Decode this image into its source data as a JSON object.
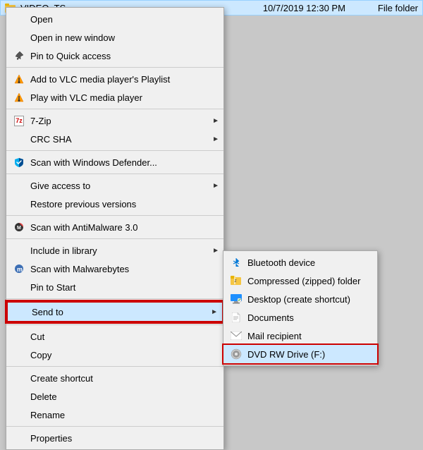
{
  "fileRow": {
    "name": "VIDEO_TS",
    "date": "10/7/2019 12:30 PM",
    "type": "File folder"
  },
  "contextMenu": {
    "items": [
      {
        "id": "open",
        "label": "Open",
        "icon": null,
        "hasArrow": false,
        "separator_after": false
      },
      {
        "id": "open-new-window",
        "label": "Open in new window",
        "icon": null,
        "hasArrow": false,
        "separator_after": false
      },
      {
        "id": "pin-quick-access",
        "label": "Pin to Quick access",
        "icon": "pin",
        "hasArrow": false,
        "separator_after": true
      },
      {
        "id": "vlc-playlist",
        "label": "Add to VLC media player's Playlist",
        "icon": "vlc",
        "hasArrow": false,
        "separator_after": false
      },
      {
        "id": "vlc-play",
        "label": "Play with VLC media player",
        "icon": "vlc",
        "hasArrow": false,
        "separator_after": true
      },
      {
        "id": "7zip",
        "label": "7-Zip",
        "icon": "7zip",
        "hasArrow": true,
        "separator_after": false
      },
      {
        "id": "crc-sha",
        "label": "CRC SHA",
        "icon": null,
        "hasArrow": true,
        "separator_after": true
      },
      {
        "id": "scan-defender",
        "label": "Scan with Windows Defender...",
        "icon": "defender",
        "hasArrow": false,
        "separator_after": true
      },
      {
        "id": "give-access",
        "label": "Give access to",
        "icon": null,
        "hasArrow": true,
        "separator_after": false
      },
      {
        "id": "restore-previous",
        "label": "Restore previous versions",
        "icon": null,
        "hasArrow": false,
        "separator_after": true
      },
      {
        "id": "scan-antimalware",
        "label": "Scan with AntiMalware 3.0",
        "icon": "antimalware",
        "hasArrow": false,
        "separator_after": true
      },
      {
        "id": "include-library",
        "label": "Include in library",
        "icon": null,
        "hasArrow": true,
        "separator_after": false
      },
      {
        "id": "scan-malwarebytes",
        "label": "Scan with Malwarebytes",
        "icon": "malwarebytes",
        "hasArrow": false,
        "separator_after": false
      },
      {
        "id": "pin-start",
        "label": "Pin to Start",
        "icon": null,
        "hasArrow": false,
        "separator_after": true
      },
      {
        "id": "send-to",
        "label": "Send to",
        "icon": null,
        "hasArrow": true,
        "separator_after": true,
        "highlighted": true
      },
      {
        "id": "cut",
        "label": "Cut",
        "icon": null,
        "hasArrow": false,
        "separator_after": false
      },
      {
        "id": "copy",
        "label": "Copy",
        "icon": null,
        "hasArrow": false,
        "separator_after": true
      },
      {
        "id": "create-shortcut",
        "label": "Create shortcut",
        "icon": null,
        "hasArrow": false,
        "separator_after": false
      },
      {
        "id": "delete",
        "label": "Delete",
        "icon": null,
        "hasArrow": false,
        "separator_after": false
      },
      {
        "id": "rename",
        "label": "Rename",
        "icon": null,
        "hasArrow": false,
        "separator_after": true
      },
      {
        "id": "properties",
        "label": "Properties",
        "icon": null,
        "hasArrow": false,
        "separator_after": false
      }
    ]
  },
  "submenu": {
    "items": [
      {
        "id": "bluetooth",
        "label": "Bluetooth device",
        "icon": "bluetooth"
      },
      {
        "id": "compressed",
        "label": "Compressed (zipped) folder",
        "icon": "zip"
      },
      {
        "id": "desktop",
        "label": "Desktop (create shortcut)",
        "icon": "desktop"
      },
      {
        "id": "documents",
        "label": "Documents",
        "icon": "doc"
      },
      {
        "id": "mail",
        "label": "Mail recipient",
        "icon": "mail"
      },
      {
        "id": "dvd",
        "label": "DVD RW Drive (F:)",
        "icon": "dvd",
        "highlighted": true
      }
    ]
  }
}
